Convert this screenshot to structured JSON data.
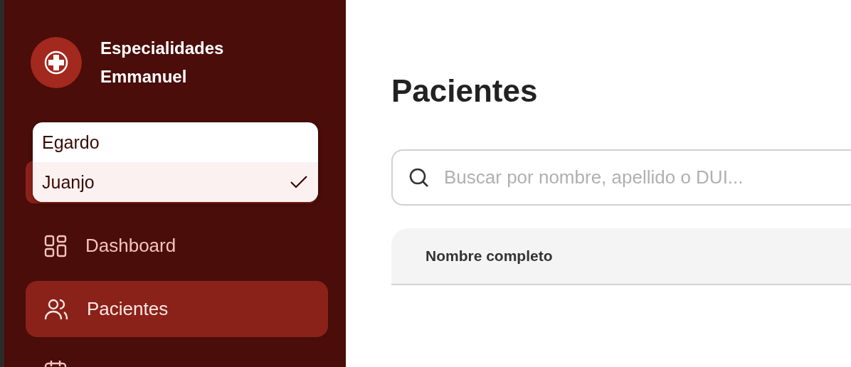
{
  "sidebar": {
    "brand": {
      "line_1": "Especialidades",
      "line_2": "Emmanuel"
    },
    "user_dropdown": {
      "options": [
        {
          "label": "Egardo",
          "selected": false
        },
        {
          "label": "Juanjo",
          "selected": true
        }
      ]
    },
    "nav_items": [
      {
        "label": "Dashboard",
        "kind": "grid",
        "selected": false
      },
      {
        "label": "Pacientes",
        "kind": "users",
        "selected": true
      },
      {
        "kind": "calendar",
        "selected": false
      }
    ]
  },
  "main": {
    "title": "Pacientes",
    "search": {
      "placeholder": "Buscar por nombre, apellido o DUI..."
    },
    "table": {
      "columns": [
        "Nombre completo"
      ]
    }
  }
}
